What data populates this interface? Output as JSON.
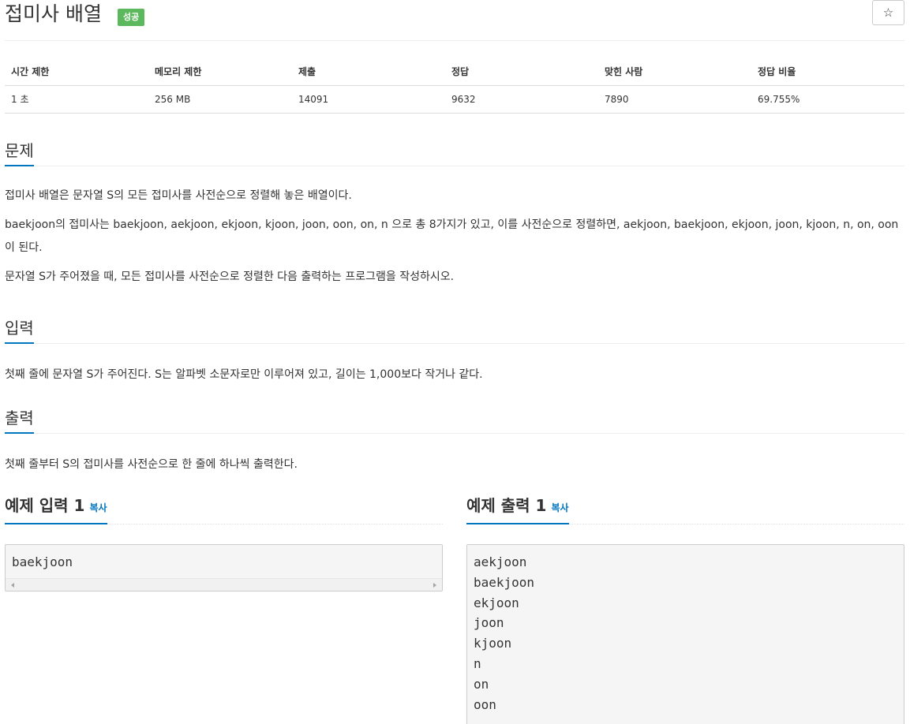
{
  "title": "접미사 배열",
  "badge": "성공",
  "star_icon": "☆",
  "info_table": {
    "headers": [
      "시간 제한",
      "메모리 제한",
      "제출",
      "정답",
      "맞힌 사람",
      "정답 비율"
    ],
    "values": [
      "1 초",
      "256 MB",
      "14091",
      "9632",
      "7890",
      "69.755%"
    ]
  },
  "problem": {
    "title": "문제",
    "paragraphs": [
      "접미사 배열은 문자열 S의 모든 접미사를 사전순으로 정렬해 놓은 배열이다.",
      "baekjoon의 접미사는 baekjoon, aekjoon, ekjoon, kjoon, joon, oon, on, n 으로 총 8가지가 있고, 이를 사전순으로 정렬하면, aekjoon, baekjoon, ekjoon, joon, kjoon, n, on, oon이 된다.",
      "문자열 S가 주어졌을 때, 모든 접미사를 사전순으로 정렬한 다음 출력하는 프로그램을 작성하시오."
    ]
  },
  "input": {
    "title": "입력",
    "text": "첫째 줄에 문자열 S가 주어진다. S는 알파벳 소문자로만 이루어져 있고, 길이는 1,000보다 작거나 같다."
  },
  "output": {
    "title": "출력",
    "text": "첫째 줄부터 S의 접미사를 사전순으로 한 줄에 하나씩 출력한다."
  },
  "sample_input": {
    "title": "예제 입력 1",
    "copy_label": "복사",
    "lines": [
      "baekjoon"
    ]
  },
  "sample_output": {
    "title": "예제 출력 1",
    "copy_label": "복사",
    "lines": [
      "aekjoon",
      "baekjoon",
      "ekjoon",
      "joon",
      "kjoon",
      "n",
      "on",
      "oon"
    ]
  },
  "colors": {
    "accent": "#0076c0",
    "badge_success": "#5cb85c"
  }
}
